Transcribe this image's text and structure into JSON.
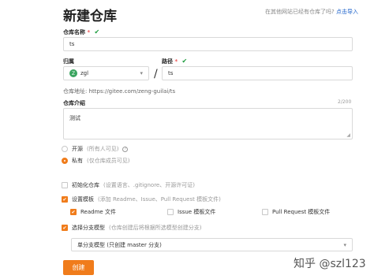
{
  "page": {
    "title": "新建仓库",
    "import_hint": "在其他网站已经有仓库了吗?",
    "import_link": "点击导入"
  },
  "repo_name": {
    "label": "仓库名称",
    "required_mark": "*",
    "value": "ts"
  },
  "owner": {
    "label": "归属",
    "avatar_letter": "Z",
    "value": "zgl"
  },
  "path": {
    "label": "路径",
    "required_mark": "*",
    "value": "ts"
  },
  "separator": "/",
  "address": {
    "label": "仓库地址:",
    "value": "https://gitee.com/zeng-guilai/ts"
  },
  "description": {
    "label": "仓库介绍",
    "counter": "2/200",
    "value": "测试"
  },
  "visibility": {
    "options": [
      {
        "label": "开源",
        "note": "(所有人可见)",
        "selected": false
      },
      {
        "label": "私有",
        "note": "(仅仓库成员可见)",
        "selected": true
      }
    ]
  },
  "init_repo": {
    "label": "初始化仓库",
    "note": "(设置语言、.gitignore、开源许可证)",
    "checked": false
  },
  "templates": {
    "label": "设置模板",
    "note": "(添加 Readme、Issue、Pull Request 模板文件)",
    "checked": true,
    "items": [
      {
        "label": "Readme 文件",
        "checked": true
      },
      {
        "label": "Issue 模板文件",
        "checked": false
      },
      {
        "label": "Pull Request 模板文件",
        "checked": false
      }
    ]
  },
  "branch_model": {
    "label": "选择分支模型",
    "note": "(仓库创建后将根据所选模型创建分支)",
    "checked": true,
    "selected": "单分支模型 (只创建 master 分支)"
  },
  "create_button": "创建",
  "watermark": "知乎 @szl123",
  "colors": {
    "accent": "#f07c1b",
    "link": "#2266cc",
    "success": "#1a9b3c",
    "required": "#e55555"
  }
}
